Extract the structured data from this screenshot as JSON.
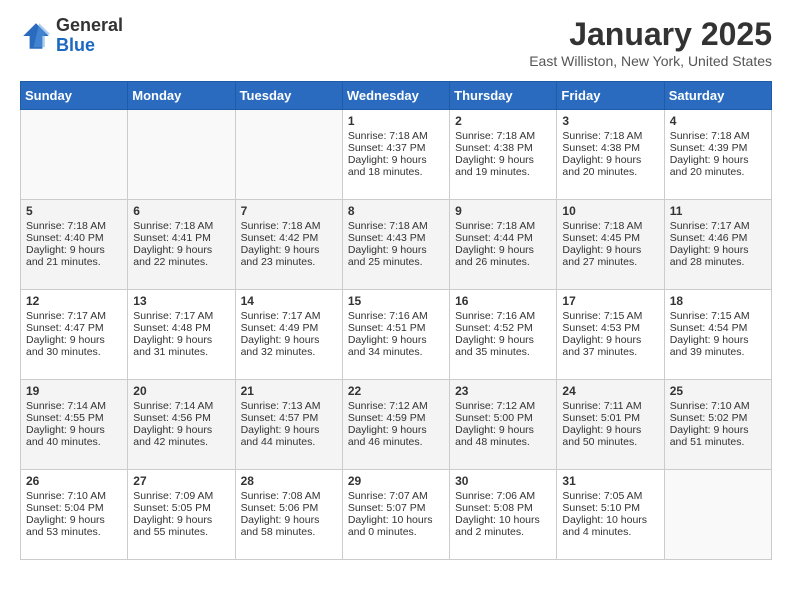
{
  "header": {
    "logo_general": "General",
    "logo_blue": "Blue",
    "month_title": "January 2025",
    "location": "East Williston, New York, United States"
  },
  "weekdays": [
    "Sunday",
    "Monday",
    "Tuesday",
    "Wednesday",
    "Thursday",
    "Friday",
    "Saturday"
  ],
  "weeks": [
    [
      {
        "day": "",
        "sunrise": "",
        "sunset": "",
        "daylight": ""
      },
      {
        "day": "",
        "sunrise": "",
        "sunset": "",
        "daylight": ""
      },
      {
        "day": "",
        "sunrise": "",
        "sunset": "",
        "daylight": ""
      },
      {
        "day": "1",
        "sunrise": "Sunrise: 7:18 AM",
        "sunset": "Sunset: 4:37 PM",
        "daylight": "Daylight: 9 hours and 18 minutes."
      },
      {
        "day": "2",
        "sunrise": "Sunrise: 7:18 AM",
        "sunset": "Sunset: 4:38 PM",
        "daylight": "Daylight: 9 hours and 19 minutes."
      },
      {
        "day": "3",
        "sunrise": "Sunrise: 7:18 AM",
        "sunset": "Sunset: 4:38 PM",
        "daylight": "Daylight: 9 hours and 20 minutes."
      },
      {
        "day": "4",
        "sunrise": "Sunrise: 7:18 AM",
        "sunset": "Sunset: 4:39 PM",
        "daylight": "Daylight: 9 hours and 20 minutes."
      }
    ],
    [
      {
        "day": "5",
        "sunrise": "Sunrise: 7:18 AM",
        "sunset": "Sunset: 4:40 PM",
        "daylight": "Daylight: 9 hours and 21 minutes."
      },
      {
        "day": "6",
        "sunrise": "Sunrise: 7:18 AM",
        "sunset": "Sunset: 4:41 PM",
        "daylight": "Daylight: 9 hours and 22 minutes."
      },
      {
        "day": "7",
        "sunrise": "Sunrise: 7:18 AM",
        "sunset": "Sunset: 4:42 PM",
        "daylight": "Daylight: 9 hours and 23 minutes."
      },
      {
        "day": "8",
        "sunrise": "Sunrise: 7:18 AM",
        "sunset": "Sunset: 4:43 PM",
        "daylight": "Daylight: 9 hours and 25 minutes."
      },
      {
        "day": "9",
        "sunrise": "Sunrise: 7:18 AM",
        "sunset": "Sunset: 4:44 PM",
        "daylight": "Daylight: 9 hours and 26 minutes."
      },
      {
        "day": "10",
        "sunrise": "Sunrise: 7:18 AM",
        "sunset": "Sunset: 4:45 PM",
        "daylight": "Daylight: 9 hours and 27 minutes."
      },
      {
        "day": "11",
        "sunrise": "Sunrise: 7:17 AM",
        "sunset": "Sunset: 4:46 PM",
        "daylight": "Daylight: 9 hours and 28 minutes."
      }
    ],
    [
      {
        "day": "12",
        "sunrise": "Sunrise: 7:17 AM",
        "sunset": "Sunset: 4:47 PM",
        "daylight": "Daylight: 9 hours and 30 minutes."
      },
      {
        "day": "13",
        "sunrise": "Sunrise: 7:17 AM",
        "sunset": "Sunset: 4:48 PM",
        "daylight": "Daylight: 9 hours and 31 minutes."
      },
      {
        "day": "14",
        "sunrise": "Sunrise: 7:17 AM",
        "sunset": "Sunset: 4:49 PM",
        "daylight": "Daylight: 9 hours and 32 minutes."
      },
      {
        "day": "15",
        "sunrise": "Sunrise: 7:16 AM",
        "sunset": "Sunset: 4:51 PM",
        "daylight": "Daylight: 9 hours and 34 minutes."
      },
      {
        "day": "16",
        "sunrise": "Sunrise: 7:16 AM",
        "sunset": "Sunset: 4:52 PM",
        "daylight": "Daylight: 9 hours and 35 minutes."
      },
      {
        "day": "17",
        "sunrise": "Sunrise: 7:15 AM",
        "sunset": "Sunset: 4:53 PM",
        "daylight": "Daylight: 9 hours and 37 minutes."
      },
      {
        "day": "18",
        "sunrise": "Sunrise: 7:15 AM",
        "sunset": "Sunset: 4:54 PM",
        "daylight": "Daylight: 9 hours and 39 minutes."
      }
    ],
    [
      {
        "day": "19",
        "sunrise": "Sunrise: 7:14 AM",
        "sunset": "Sunset: 4:55 PM",
        "daylight": "Daylight: 9 hours and 40 minutes."
      },
      {
        "day": "20",
        "sunrise": "Sunrise: 7:14 AM",
        "sunset": "Sunset: 4:56 PM",
        "daylight": "Daylight: 9 hours and 42 minutes."
      },
      {
        "day": "21",
        "sunrise": "Sunrise: 7:13 AM",
        "sunset": "Sunset: 4:57 PM",
        "daylight": "Daylight: 9 hours and 44 minutes."
      },
      {
        "day": "22",
        "sunrise": "Sunrise: 7:12 AM",
        "sunset": "Sunset: 4:59 PM",
        "daylight": "Daylight: 9 hours and 46 minutes."
      },
      {
        "day": "23",
        "sunrise": "Sunrise: 7:12 AM",
        "sunset": "Sunset: 5:00 PM",
        "daylight": "Daylight: 9 hours and 48 minutes."
      },
      {
        "day": "24",
        "sunrise": "Sunrise: 7:11 AM",
        "sunset": "Sunset: 5:01 PM",
        "daylight": "Daylight: 9 hours and 50 minutes."
      },
      {
        "day": "25",
        "sunrise": "Sunrise: 7:10 AM",
        "sunset": "Sunset: 5:02 PM",
        "daylight": "Daylight: 9 hours and 51 minutes."
      }
    ],
    [
      {
        "day": "26",
        "sunrise": "Sunrise: 7:10 AM",
        "sunset": "Sunset: 5:04 PM",
        "daylight": "Daylight: 9 hours and 53 minutes."
      },
      {
        "day": "27",
        "sunrise": "Sunrise: 7:09 AM",
        "sunset": "Sunset: 5:05 PM",
        "daylight": "Daylight: 9 hours and 55 minutes."
      },
      {
        "day": "28",
        "sunrise": "Sunrise: 7:08 AM",
        "sunset": "Sunset: 5:06 PM",
        "daylight": "Daylight: 9 hours and 58 minutes."
      },
      {
        "day": "29",
        "sunrise": "Sunrise: 7:07 AM",
        "sunset": "Sunset: 5:07 PM",
        "daylight": "Daylight: 10 hours and 0 minutes."
      },
      {
        "day": "30",
        "sunrise": "Sunrise: 7:06 AM",
        "sunset": "Sunset: 5:08 PM",
        "daylight": "Daylight: 10 hours and 2 minutes."
      },
      {
        "day": "31",
        "sunrise": "Sunrise: 7:05 AM",
        "sunset": "Sunset: 5:10 PM",
        "daylight": "Daylight: 10 hours and 4 minutes."
      },
      {
        "day": "",
        "sunrise": "",
        "sunset": "",
        "daylight": ""
      }
    ]
  ]
}
